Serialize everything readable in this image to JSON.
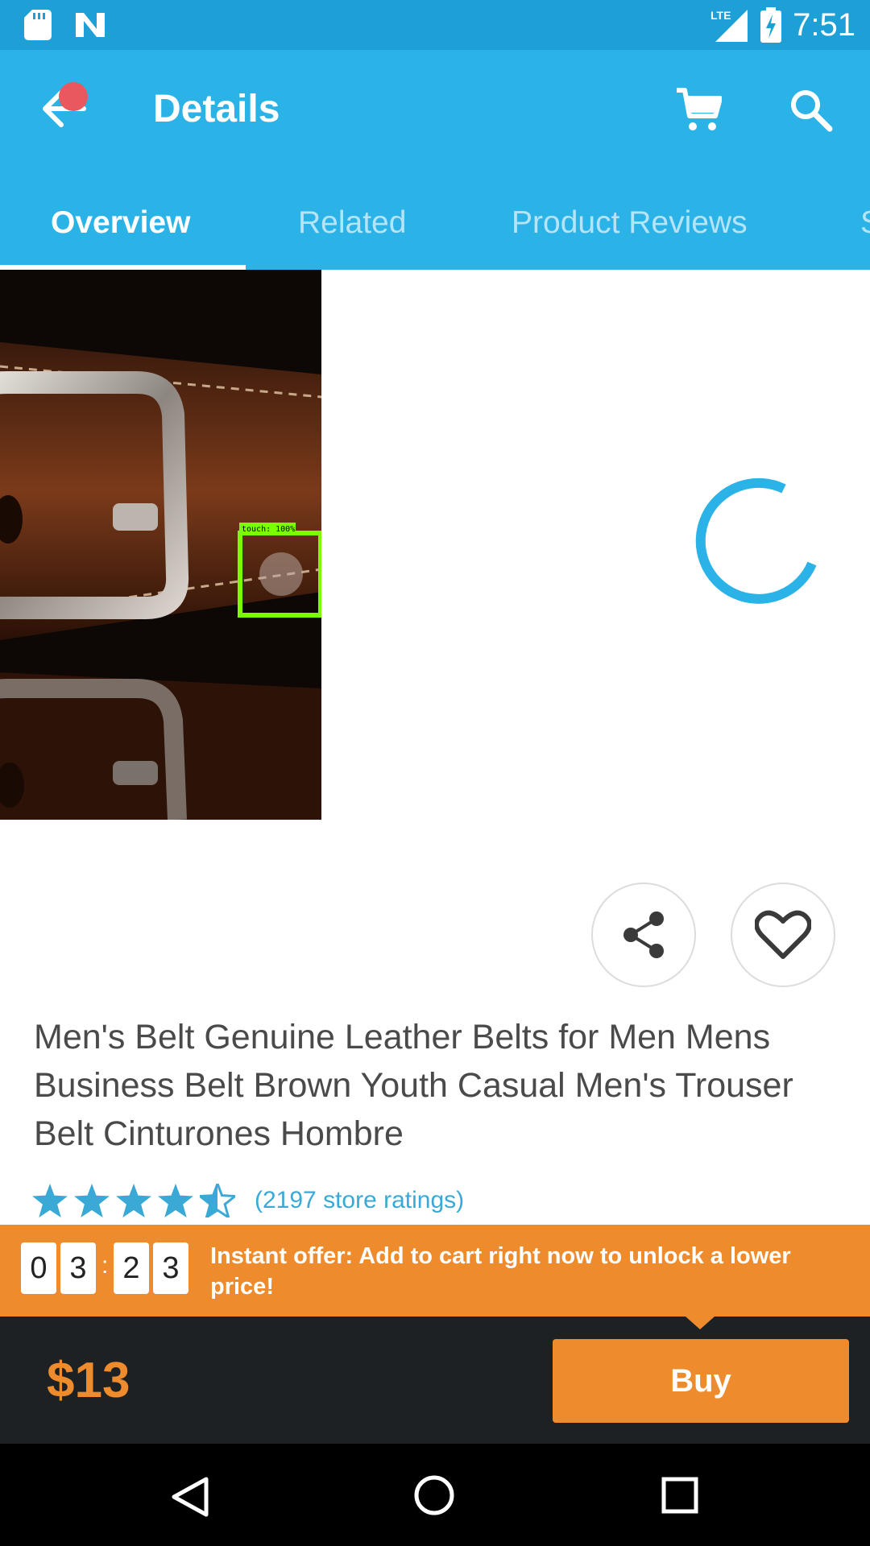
{
  "status_bar": {
    "time": "7:51",
    "network": "LTE",
    "icons": [
      "sd-card-icon",
      "n-logo-icon",
      "lte-signal-icon",
      "battery-charging-icon"
    ]
  },
  "app_bar": {
    "title": "Details",
    "icons": [
      "back-arrow-icon",
      "cart-icon",
      "search-icon"
    ],
    "accent_color": "#2bb3e8"
  },
  "tabs": [
    {
      "label": "Overview",
      "active": true
    },
    {
      "label": "Related",
      "active": false
    },
    {
      "label": "Product Reviews",
      "active": false
    },
    {
      "label": "S",
      "active": false
    }
  ],
  "product": {
    "title": "Men's Belt Genuine Leather Belts for Men Mens Business Belt Brown Youth Casual Men's Trouser Belt Cinturones Hombre",
    "rating": 4.5,
    "ratings_text": "(2197 store ratings)",
    "overlay_label": "touch: 100%"
  },
  "actions": {
    "share_icon": "share-icon",
    "wishlist_icon": "heart-icon"
  },
  "offer": {
    "timer": [
      "0",
      "3",
      "2",
      "3"
    ],
    "separator": ":",
    "text": "Instant offer: Add to cart right now to unlock a lower price!",
    "color": "#ee8c2d"
  },
  "purchase": {
    "price": "$13",
    "buy_label": "Buy"
  },
  "nav_bar": {
    "icons": [
      "back-triangle-icon",
      "home-circle-icon",
      "recents-square-icon"
    ]
  }
}
